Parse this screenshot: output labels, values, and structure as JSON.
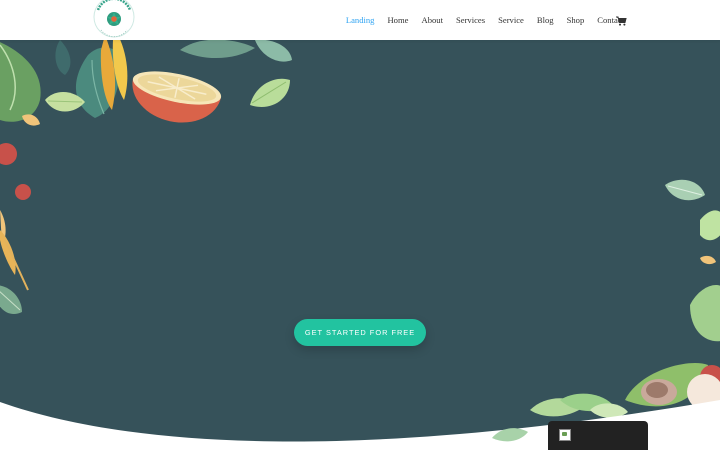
{
  "header": {
    "logo_text": "HEALING & WHOLENESS",
    "nav": [
      {
        "label": "Landing",
        "active": true
      },
      {
        "label": "Home",
        "active": false
      },
      {
        "label": "About",
        "active": false
      },
      {
        "label": "Services",
        "active": false
      },
      {
        "label": "Service",
        "active": false
      },
      {
        "label": "Blog",
        "active": false
      },
      {
        "label": "Shop",
        "active": false
      },
      {
        "label": "Contact",
        "active": false
      }
    ],
    "cart_icon": "cart-icon"
  },
  "hero": {
    "cta_label": "GET STARTED FOR FREE"
  },
  "chat_widget": {
    "icon": "broken-image-icon"
  },
  "colors": {
    "nav_active": "#2ea3f2",
    "hero_bg": "#36525a",
    "cta_bg": "#22c3a0"
  }
}
